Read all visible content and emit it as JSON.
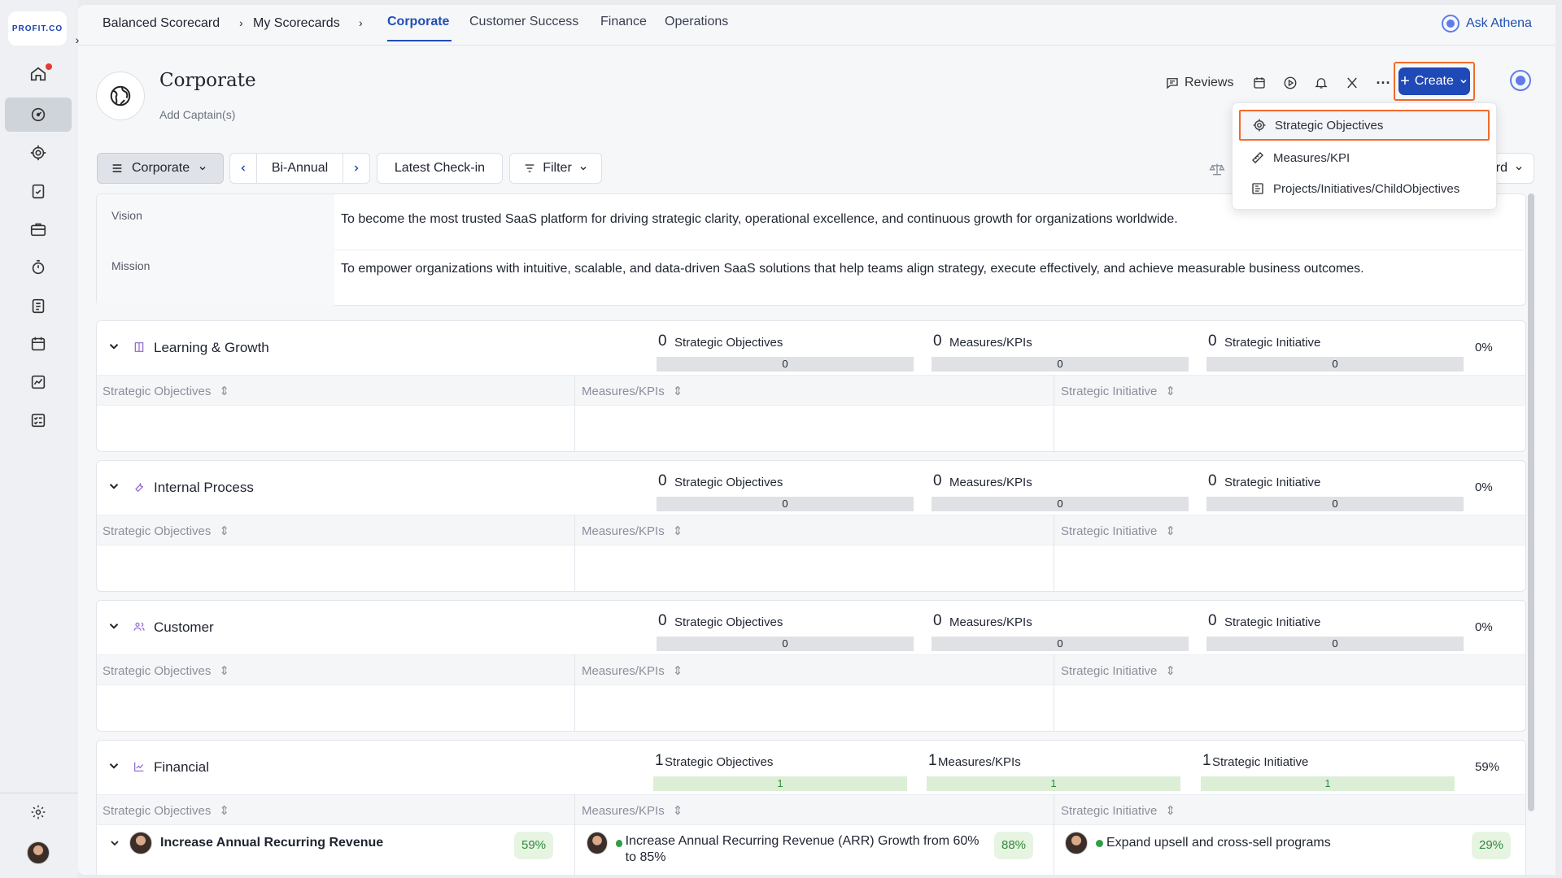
{
  "app": {
    "logo_text": "PROFIT.CO"
  },
  "rail": {
    "items": [
      "home-icon",
      "dashboard-icon",
      "target-icon",
      "clipboard-check-icon",
      "briefcase-icon",
      "stopwatch-icon",
      "checklist-icon",
      "calendar-icon",
      "line-chart-icon",
      "list-check-icon"
    ],
    "settings": "gear-icon"
  },
  "breadcrumb": {
    "root": "Balanced Scorecard",
    "sep1": "›",
    "level2": "My Scorecards",
    "sep2": "›"
  },
  "tabs": [
    "Corporate",
    "Customer Success",
    "Finance",
    "Operations"
  ],
  "ask_athena": "Ask Athena",
  "header": {
    "title": "Corporate",
    "captain": "Add Captain(s)"
  },
  "tools": {
    "reviews": "Reviews",
    "more": "···",
    "create": "Create"
  },
  "dropdown": {
    "items": [
      "Strategic Objectives",
      "Measures/KPI",
      "Projects/Initiatives/ChildObjectives"
    ]
  },
  "toolbar": {
    "scorecard": "Corporate",
    "period": "Bi-Annual",
    "checkin": "Latest Check-in",
    "filter": "Filter",
    "view_partial": "rd"
  },
  "vision": {
    "label": "Vision",
    "text": "To become the most trusted SaaS platform for driving strategic clarity, operational excellence, and continuous growth for organizations worldwide."
  },
  "mission": {
    "label": "Mission",
    "text": "To empower organizations with intuitive, scalable, and data-driven SaaS solutions that help teams align strategy, execute effectively, and achieve measurable business outcomes."
  },
  "columns": [
    "Strategic Objectives",
    "Measures/KPIs",
    "Strategic Initiative"
  ],
  "perspectives": [
    {
      "name": "Learning & Growth",
      "so_count": "0",
      "so_label": "Strategic Objectives",
      "so_bar": "0",
      "kpi_count": "0",
      "kpi_label": "Measures/KPIs",
      "kpi_bar": "0",
      "si_count": "0",
      "si_label": "Strategic Initiative",
      "si_bar": "0",
      "pct": "0%"
    },
    {
      "name": "Internal Process",
      "so_count": "0",
      "so_label": "Strategic Objectives",
      "so_bar": "0",
      "kpi_count": "0",
      "kpi_label": "Measures/KPIs",
      "kpi_bar": "0",
      "si_count": "0",
      "si_label": "Strategic Initiative",
      "si_bar": "0",
      "pct": "0%"
    },
    {
      "name": "Customer",
      "so_count": "0",
      "so_label": "Strategic Objectives",
      "so_bar": "0",
      "kpi_count": "0",
      "kpi_label": "Measures/KPIs",
      "kpi_bar": "0",
      "si_count": "0",
      "si_label": "Strategic Initiative",
      "si_bar": "0",
      "pct": "0%"
    },
    {
      "name": "Financial",
      "so_count": "1",
      "so_label": "Strategic Objectives",
      "so_bar": "1",
      "kpi_count": "1",
      "kpi_label": "Measures/KPIs",
      "kpi_bar": "1",
      "si_count": "1",
      "si_label": "Strategic Initiative",
      "si_bar": "1",
      "pct": "59%"
    }
  ],
  "financial_rows": {
    "objective": {
      "text": "Increase Annual Recurring Revenue",
      "pct": "59%"
    },
    "kpi": {
      "text": "Increase Annual Recurring Revenue (ARR) Growth from 60% to 85%",
      "pct": "88%"
    },
    "initiative": {
      "text": "Expand upsell and cross-sell programs",
      "pct": "29%"
    }
  },
  "colors": {
    "accent": "#1e49b6",
    "highlight": "#f26b2b",
    "green": "#2e9e44"
  }
}
